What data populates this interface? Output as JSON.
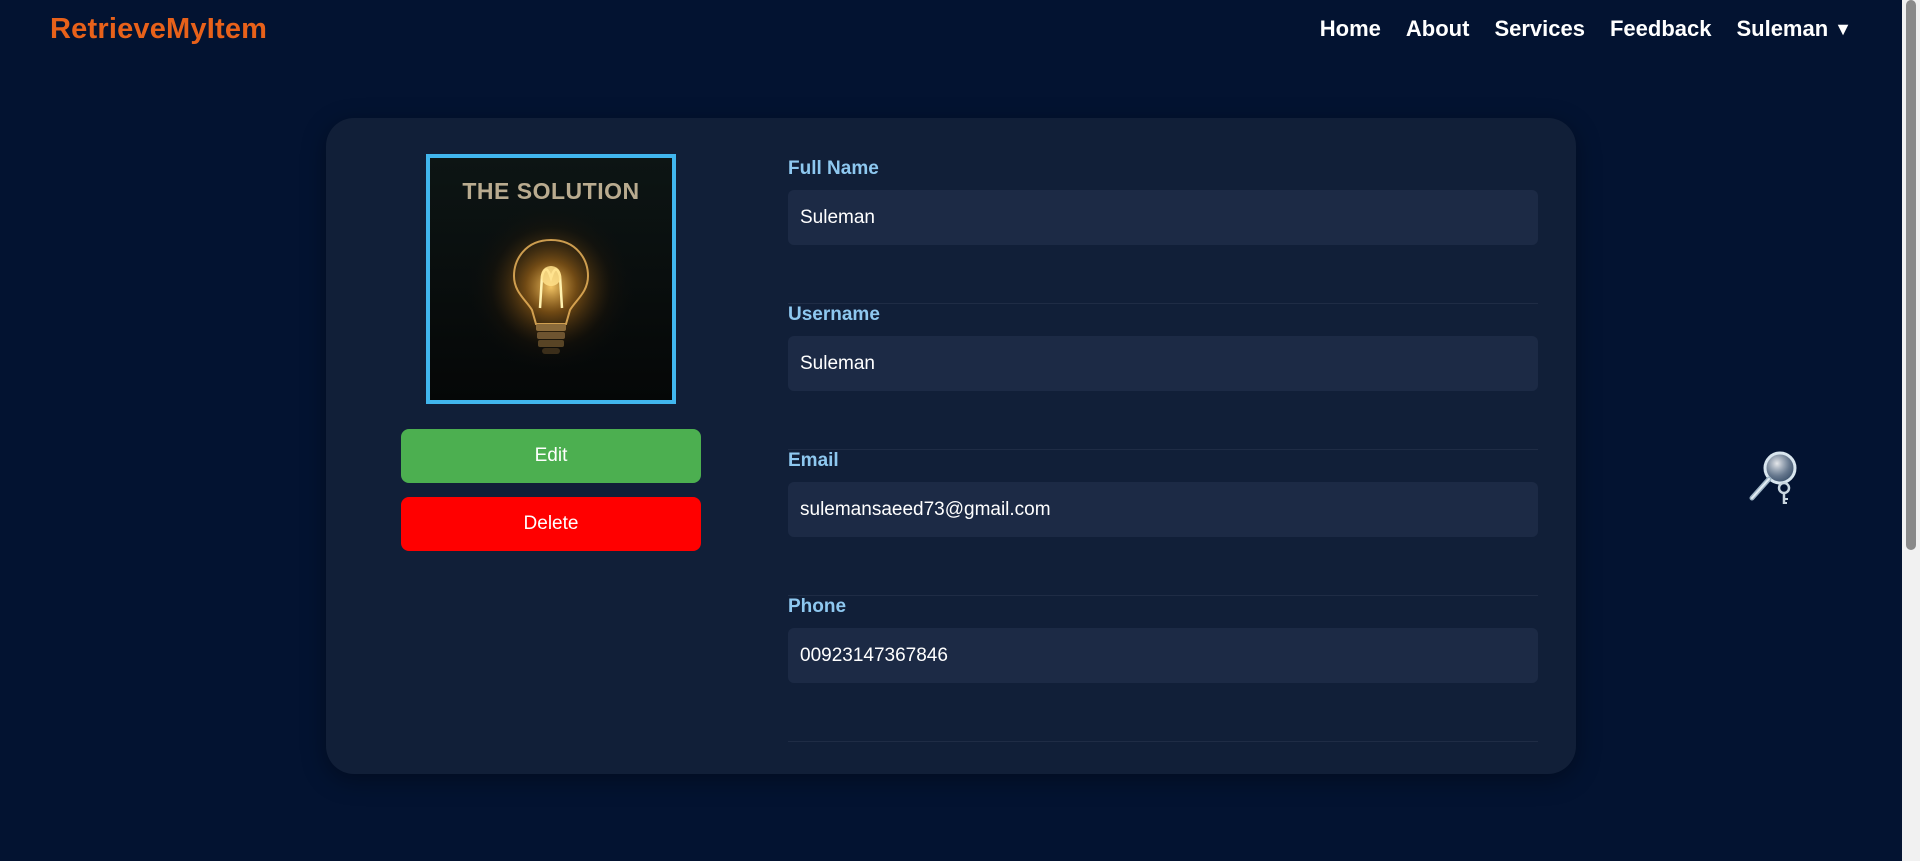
{
  "navbar": {
    "brand": "RetrieveMyItem",
    "links": [
      "Home",
      "About",
      "Services",
      "Feedback"
    ],
    "user": "Suleman",
    "caret": "▼"
  },
  "profile": {
    "image_caption": "THE SOLUTION",
    "edit_label": "Edit",
    "delete_label": "Delete"
  },
  "fields": [
    {
      "label": "Full Name",
      "value": "Suleman"
    },
    {
      "label": "Username",
      "value": "Suleman"
    },
    {
      "label": "Email",
      "value": "sulemansaeed73@gmail.com"
    },
    {
      "label": "Phone",
      "value": "00923147367846"
    }
  ],
  "colors": {
    "background": "#031331",
    "card": "#111f38",
    "brand": "#e8611a",
    "label": "#8ec8f0",
    "input_bg": "#1c2a45",
    "edit": "#4caf50",
    "delete": "#ff0000",
    "avatar_border": "#41b6ee"
  },
  "icons": {
    "floating": "magnifier-key-icon",
    "avatar": "lightbulb-icon"
  }
}
